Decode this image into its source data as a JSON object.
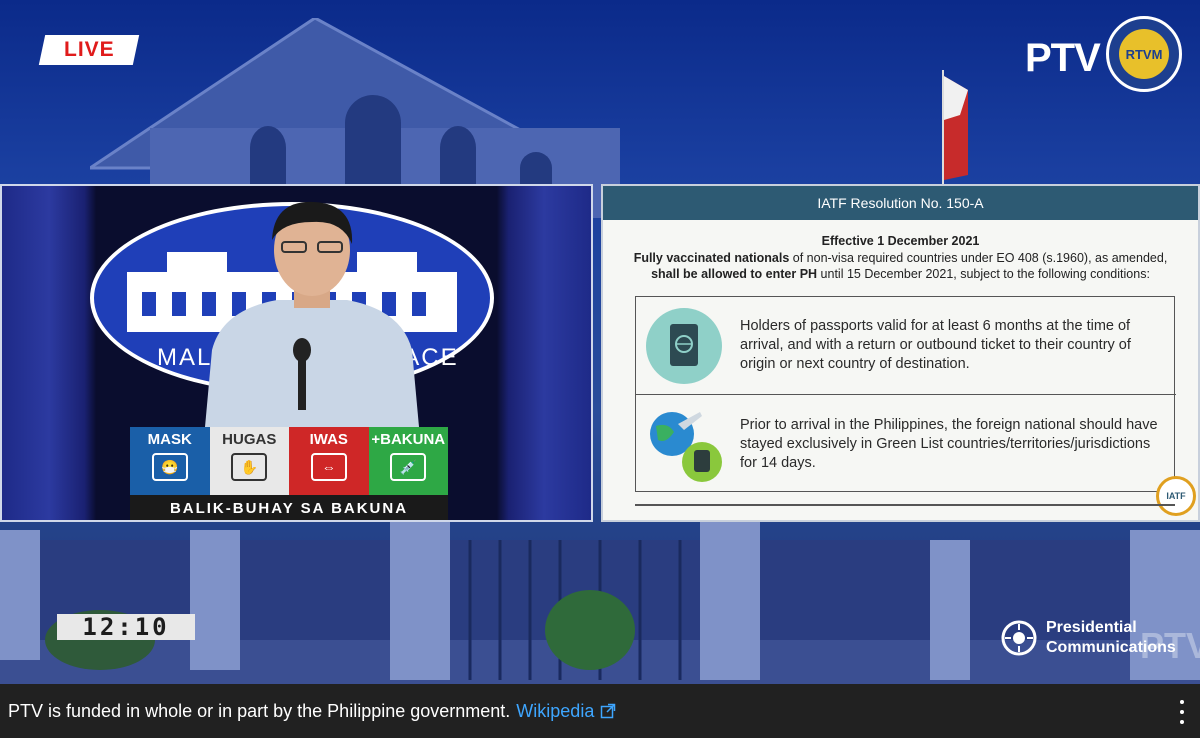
{
  "overlay": {
    "live_label": "LIVE",
    "channel_logo": "PTV",
    "network_seal_text": "RTVM",
    "time": "12:10",
    "pcoo_line1": "Presidential",
    "pcoo_line2": "Communications",
    "watermark": "PTV"
  },
  "speaker_panel": {
    "seal_text": "MALACAÑANG PALACE",
    "podium": {
      "cells": [
        {
          "label": "MASK",
          "icon": "face-mask-icon"
        },
        {
          "label": "HUGAS",
          "icon": "hand-wash-icon"
        },
        {
          "label": "IWAS",
          "icon": "distance-icon"
        },
        {
          "label": "+BAKUNA",
          "icon": "syringe-icon"
        }
      ],
      "slogan": "BALIK-BUHAY SA BAKUNA"
    }
  },
  "slide": {
    "header": "IATF Resolution No. 150-A",
    "effective": "Effective 1 December 2021",
    "lead_bold_1": "Fully vaccinated nationals",
    "lead_1": " of non-visa required countries under EO 408 (s.1960), as amended,",
    "lead_bold_2": "shall be allowed to enter PH",
    "lead_2": " until 15 December 2021, subject to the following conditions:",
    "conditions": [
      {
        "icon": "passport-icon",
        "text": "Holders of passports valid for at least 6 months at the time of arrival, and with a return or outbound ticket to their country of origin or next country of destination."
      },
      {
        "icon": "globe-travel-icon",
        "text": "Prior to arrival in the Philippines, the foreign national should have stayed exclusively in Green List countries/territories/jurisdictions for 14 days."
      }
    ],
    "badge": "IATF"
  },
  "info_bar": {
    "text": "PTV is funded in whole or in part by the Philippine government.",
    "link": "Wikipedia"
  }
}
